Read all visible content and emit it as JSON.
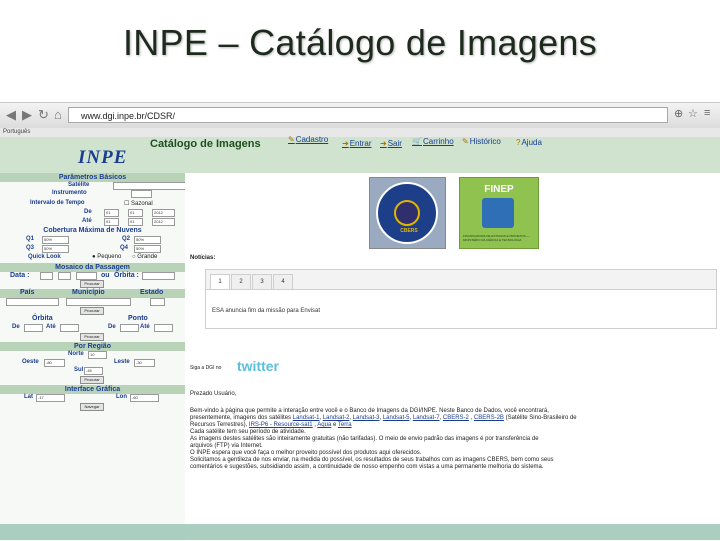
{
  "slide": {
    "title": "INPE – Catálogo de Imagens"
  },
  "browser": {
    "url": "www.dgi.inpe.br/CDSR/",
    "bookmarks": "Português"
  },
  "site": {
    "logo": "INPE",
    "title": "Catálogo de Imagens",
    "menu": [
      "Cadastro",
      "Entrar",
      "Sair",
      "Carrinho",
      "Histórico",
      "Ajuda"
    ]
  },
  "sidebar": {
    "basic_params": "Parâmetros Básicos",
    "satellite_label": "Satélite",
    "instrument_label": "Instrumento",
    "interval_label": "Intervalo de Tempo",
    "seasonal_label": "Sazonal",
    "from_label": "De",
    "to_label": "Até",
    "from_day": "01",
    "from_month": "01",
    "from_year": "2012",
    "to_day": "01",
    "to_month": "01",
    "to_year": "2012",
    "cloud_cover": "Cobertura Máxima de Nuvens",
    "q1": "Q1",
    "q2": "Q2",
    "q3": "Q3",
    "q4": "Q4",
    "q_value": "50%",
    "quicklook_label": "Quick Look",
    "small_label": "Pequeno",
    "large_label": "Grande",
    "mosaic": "Mosaico da Passagem",
    "data_label": "Data :",
    "or_label": "ou",
    "orbita_label": "Órbita :",
    "search_button": "Procurar",
    "country_label": "País",
    "city_label": "Município",
    "state_label": "Estado",
    "orbit_section": "Órbita",
    "point_section": "Ponto",
    "de_label": "De",
    "ate_label": "Até",
    "region_section": "Por Região",
    "north_label": "Norte",
    "west_label": "Oeste",
    "east_label": "Leste",
    "south_label": "Sul",
    "north_value": "10",
    "west_value": "-80",
    "east_value": "-30",
    "south_value": "-45",
    "graphic_section": "Interface Gráfica",
    "lat_label": "Lat",
    "lon_label": "Lon",
    "lat_value": "-17",
    "lon_value": "-60",
    "navigate_button": "Navegar"
  },
  "main": {
    "cbers_text": "CBERS",
    "finep_word": "FINEP",
    "finep_sub": "FINANCIADORA DE ESTUDOS E PROJETOS — MINISTÉRIO DA CIÊNCIA E TECNOLOGIA",
    "news_label": "Notícias:",
    "tabs": [
      "1",
      "2",
      "3",
      "4"
    ],
    "news_message": "ESA anuncia fim da missão para Envisat",
    "follow_label": "Siga a DGI no",
    "twitter": "twitter",
    "greeting": "Prezado Usuário,",
    "body": {
      "l1": "Bem-vindo à página que permite a interação entre você e o Banco de Imagens da DGI/INPE. Neste Banco de Dados, você encontrará,",
      "l2a": "presentemente, imagens dos satélites",
      "links": [
        "Landsat-1",
        "Landsat-2",
        "Landsat-3",
        "Landsat-5",
        "Landsat-7",
        "CBERS-2",
        "CBERS-2B",
        "IRS-P6 - Resource-sat1",
        "Aqua",
        "Terra"
      ],
      "l2b": "(Satélite Sino-Brasileiro de",
      "l3a": "Recursos Terrestres),",
      "l4": "Cada satélite tem seu período de atividade.",
      "l5": "As imagens destes satélites são inteiramente gratuitas (não tarifadas). O meio de envio padrão das imagens é por transferência de",
      "l6": "arquivos (FTP) via Internet.",
      "l7": "O INPE espera que você faça o melhor proveito possível dos produtos aqui oferecidos.",
      "l8": "Solicitamos a gentileza de nos enviar, na medida do possível, os resultados de seus trabalhos com as imagens CBERS, bem como seus",
      "l9": "comentários e sugestões, subsidiando assim, a continuidade de nosso empenho com vistas a uma permanente melhoria do sistema."
    }
  }
}
